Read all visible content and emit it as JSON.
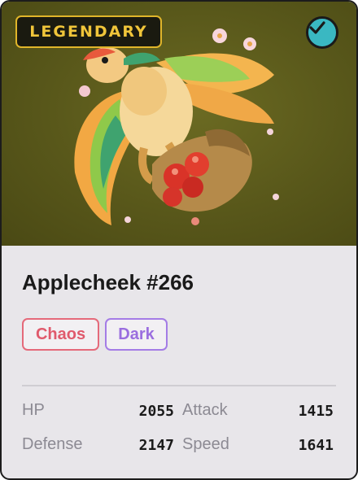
{
  "card": {
    "rarity": "LEGENDARY",
    "verified_icon": "checkmark-icon",
    "name": "Applecheek #266",
    "types": [
      "Chaos",
      "Dark"
    ],
    "stats": [
      {
        "label": "HP",
        "value": "2055"
      },
      {
        "label": "Attack",
        "value": "1415"
      },
      {
        "label": "Defense",
        "value": "2147"
      },
      {
        "label": "Speed",
        "value": "1641"
      }
    ]
  },
  "colors": {
    "art_background": "#58571a",
    "rarity_gold": "#e0b52a",
    "verified_teal": "#3ab8c2",
    "chaos": "#e05a6c",
    "dark": "#9a6ddf"
  }
}
